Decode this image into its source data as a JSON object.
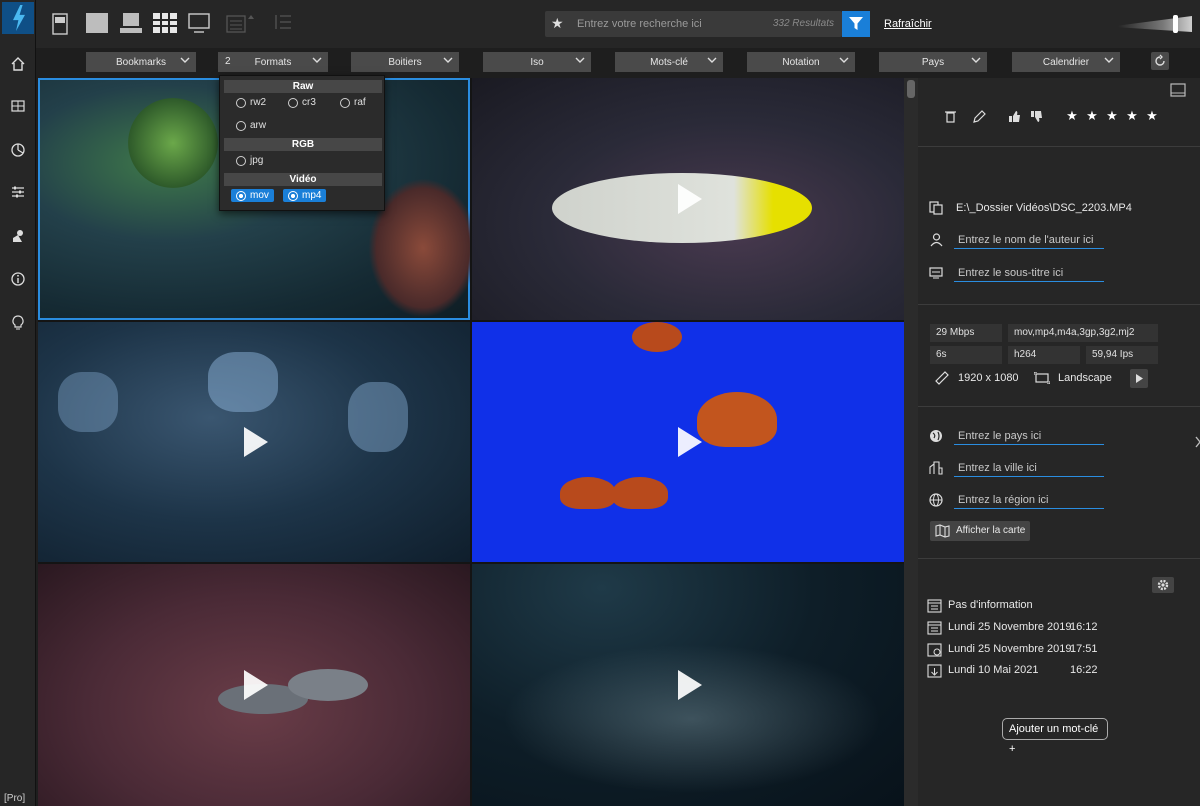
{
  "toolbar": {
    "search_placeholder": "Entrez votre recherche ici",
    "results_count": "332 Resultats",
    "refresh_label": "Rafraîchir"
  },
  "filters": {
    "bookmarks": "Bookmarks",
    "formats_count": "2",
    "formats": "Formats",
    "boitiers": "Boitiers",
    "iso": "Iso",
    "mots_cle": "Mots-clé",
    "notation": "Notation",
    "pays": "Pays",
    "calendrier": "Calendrier"
  },
  "formats_popup": {
    "raw_title": "Raw",
    "raw_options": [
      "rw2",
      "cr3",
      "raf",
      "arw"
    ],
    "rgb_title": "RGB",
    "rgb_options": [
      "jpg"
    ],
    "video_title": "Vidéo",
    "video_options": [
      "mov",
      "mp4"
    ],
    "video_selected": [
      "mov",
      "mp4"
    ]
  },
  "grid": {
    "thumbnails": [
      {
        "subject": "aquarium lionfish",
        "video": false,
        "selected": true
      },
      {
        "subject": "yellow-headed fish",
        "video": true
      },
      {
        "subject": "comb jellies",
        "video": true
      },
      {
        "subject": "orange jellyfish on blue",
        "video": true
      },
      {
        "subject": "reef with fish and feather worms",
        "video": true
      },
      {
        "subject": "school of fish",
        "video": true
      }
    ]
  },
  "panel": {
    "file_path": "E:\\_Dossier Vidéos\\DSC_2203.MP4",
    "author_placeholder": "Entrez le nom de l'auteur ici",
    "subtitle_placeholder": "Entrez le sous-titre ici",
    "bitrate": "29 Mbps",
    "formats_list": "mov,mp4,m4a,3gp,3g2,mj2",
    "duration": "6s",
    "codec": "h264",
    "fps": "59,94 Ips",
    "resolution": "1920 x 1080",
    "orientation": "Landscape",
    "country_placeholder": "Entrez le pays ici",
    "city_placeholder": "Entrez la ville ici",
    "region_placeholder": "Entrez la région ici",
    "map_button": "Afficher la carte",
    "dates": [
      {
        "date": "Pas d'information",
        "time": ""
      },
      {
        "date": "Lundi 25 Novembre 2019",
        "time": "16:12"
      },
      {
        "date": "Lundi 25 Novembre 2019",
        "time": "17:51"
      },
      {
        "date": "Lundi 10 Mai 2021",
        "time": "16:22"
      }
    ],
    "add_keyword": "Ajouter un mot-clé +"
  },
  "footer": {
    "edition": "[Pro]"
  },
  "colors": {
    "accent": "#1a7fd8",
    "selection": "#2a8de0"
  }
}
